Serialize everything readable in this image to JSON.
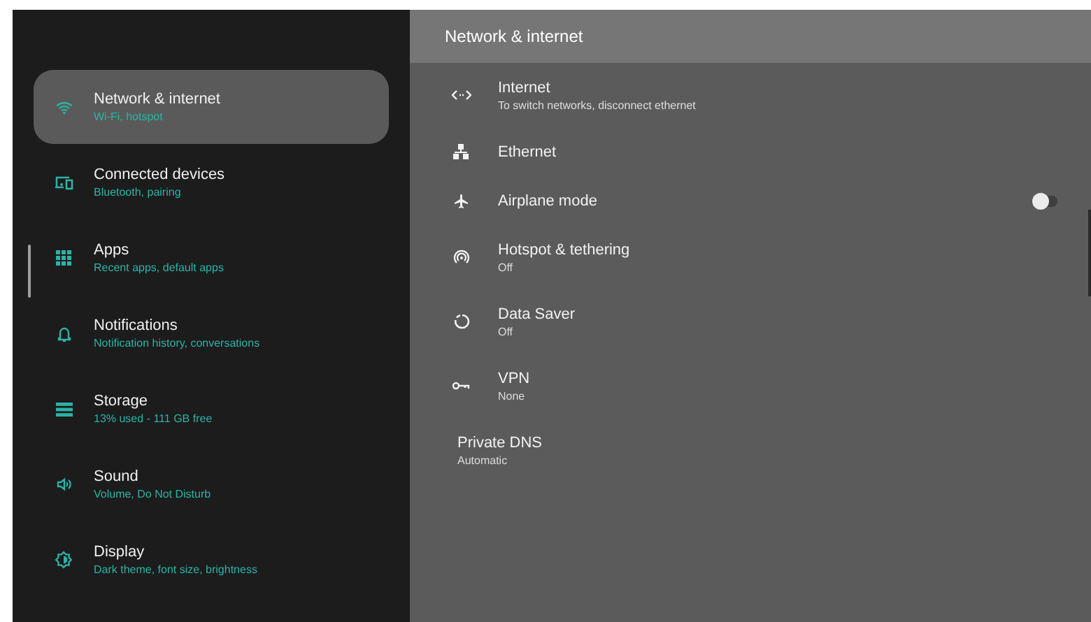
{
  "sidebar": {
    "items": [
      {
        "title": "Network & internet",
        "subtitle": "Wi-Fi, hotspot",
        "selected": true
      },
      {
        "title": "Connected devices",
        "subtitle": "Bluetooth, pairing",
        "selected": false
      },
      {
        "title": "Apps",
        "subtitle": "Recent apps, default apps",
        "selected": false
      },
      {
        "title": "Notifications",
        "subtitle": "Notification history, conversations",
        "selected": false
      },
      {
        "title": "Storage",
        "subtitle": "13% used - 111 GB free",
        "selected": false
      },
      {
        "title": "Sound",
        "subtitle": "Volume, Do Not Disturb",
        "selected": false
      },
      {
        "title": "Display",
        "subtitle": "Dark theme, font size, brightness",
        "selected": false
      }
    ]
  },
  "content": {
    "title": "Network & internet",
    "items": [
      {
        "kind": "link",
        "title": "Internet",
        "subtitle": "To switch networks, disconnect ethernet"
      },
      {
        "kind": "link",
        "title": "Ethernet"
      },
      {
        "kind": "toggle",
        "title": "Airplane mode",
        "on": false
      },
      {
        "kind": "link",
        "title": "Hotspot & tethering",
        "subtitle": "Off"
      },
      {
        "kind": "link",
        "title": "Data Saver",
        "subtitle": "Off"
      },
      {
        "kind": "link",
        "title": "VPN",
        "subtitle": "None"
      },
      {
        "kind": "text",
        "title": "Private DNS",
        "subtitle": "Automatic"
      }
    ]
  }
}
